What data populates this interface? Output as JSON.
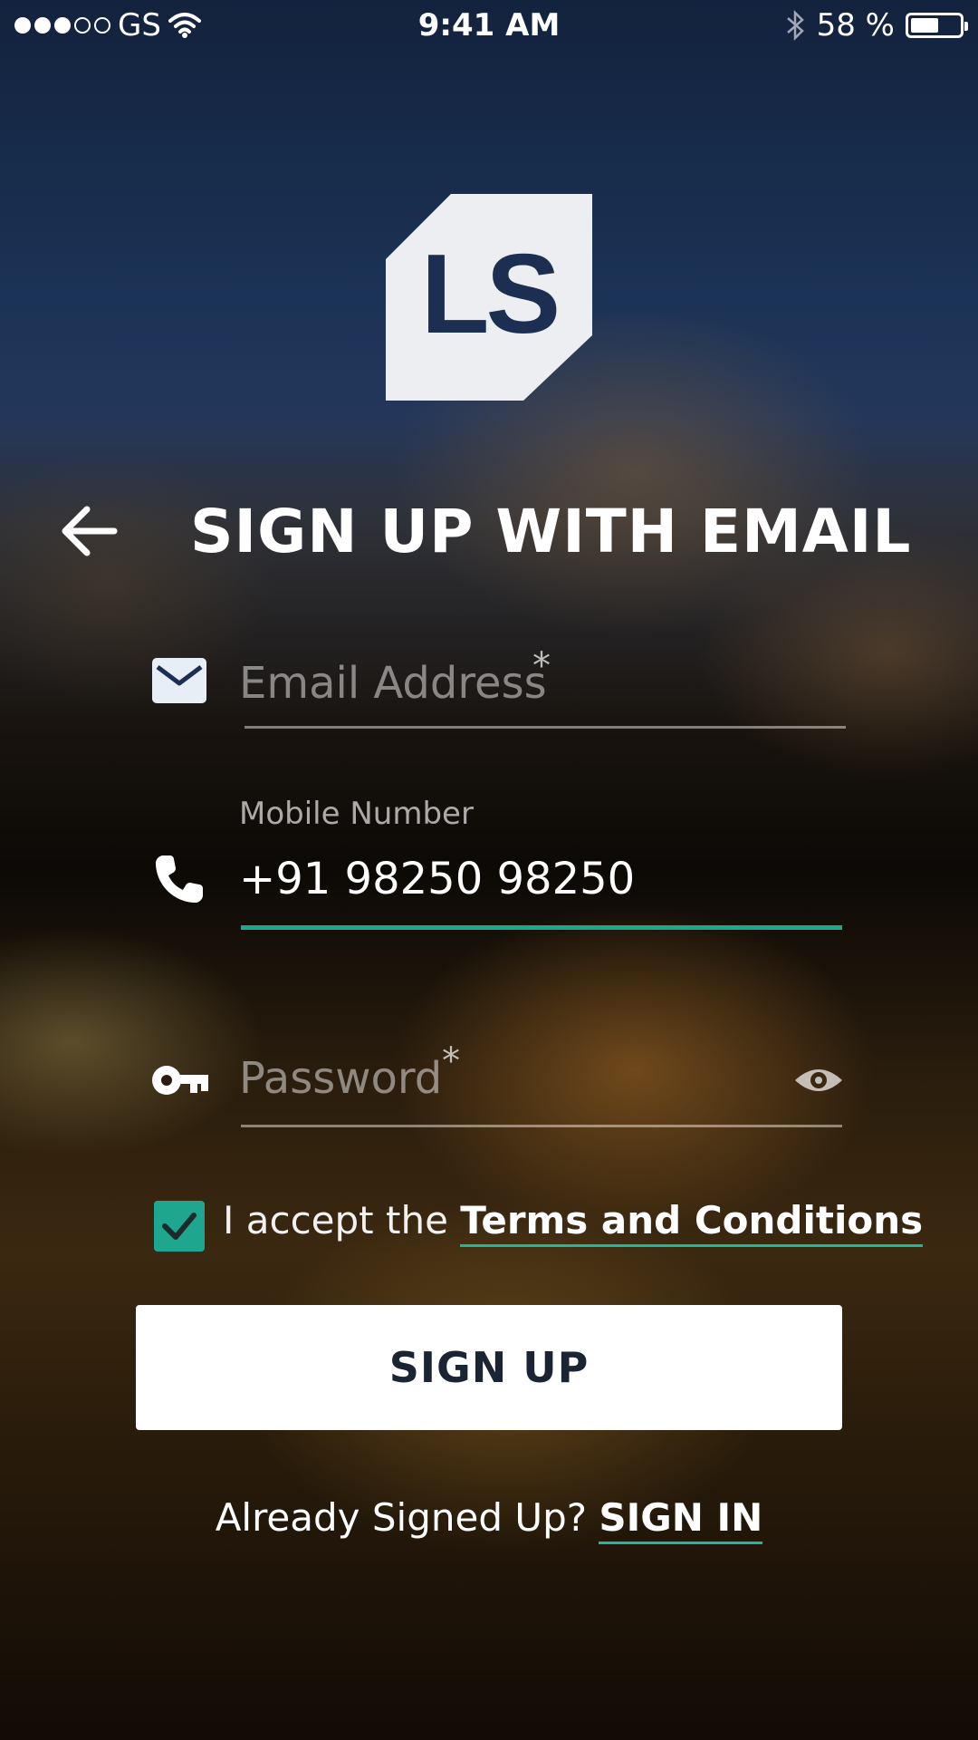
{
  "status_bar": {
    "carrier": "GS",
    "time": "9:41 AM",
    "battery_text": "58 %",
    "battery_level": 0.58,
    "signal_bars_filled": 3,
    "signal_bars_total": 5
  },
  "logo": {
    "text": "LS"
  },
  "header": {
    "title": "SIGN UP WITH EMAIL"
  },
  "form": {
    "email": {
      "placeholder": "Email Address",
      "required_mark": "*",
      "icon": "envelope-icon"
    },
    "mobile": {
      "label": "Mobile Number",
      "value": "+91 98250 98250",
      "icon": "phone-icon"
    },
    "password": {
      "placeholder": "Password",
      "required_mark": "*",
      "icon": "key-icon",
      "toggle_icon": "eye-icon"
    },
    "terms": {
      "prefix": "I accept the",
      "link": "Terms and Conditions",
      "checked": true
    },
    "submit_label": "SIGN UP"
  },
  "footer": {
    "prompt": "Already Signed Up?",
    "link": "SIGN IN"
  },
  "colors": {
    "accent": "#1fa68e",
    "logo_bg": "#eceef2",
    "logo_text": "#1c2f52",
    "button_text": "#1b2433"
  }
}
